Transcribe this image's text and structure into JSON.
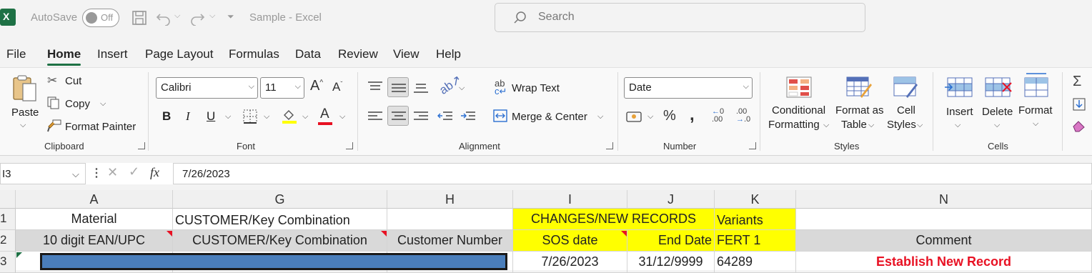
{
  "titlebar": {
    "app_icon": "excel-logo-icon",
    "autosave_label": "AutoSave",
    "autosave_state": "Off",
    "doc_title": "Sample  -  Excel",
    "search_placeholder": "Search"
  },
  "menu": {
    "tabs": [
      "File",
      "Home",
      "Insert",
      "Page Layout",
      "Formulas",
      "Data",
      "Review",
      "View",
      "Help"
    ],
    "active": "Home"
  },
  "ribbon": {
    "clipboard": {
      "paste": "Paste",
      "cut": "Cut",
      "copy": "Copy",
      "format_painter": "Format Painter",
      "label": "Clipboard"
    },
    "font": {
      "name": "Calibri",
      "size": "11",
      "label": "Font",
      "bold": "B",
      "italic": "I",
      "underline": "U"
    },
    "alignment": {
      "wrap": "Wrap Text",
      "merge": "Merge & Center",
      "label": "Alignment"
    },
    "number": {
      "format": "Date",
      "label": "Number"
    },
    "styles": {
      "conditional_1": "Conditional",
      "conditional_2": "Formatting",
      "table_1": "Format as",
      "table_2": "Table",
      "cell_1": "Cell",
      "cell_2": "Styles",
      "label": "Styles"
    },
    "cells": {
      "insert": "Insert",
      "delete": "Delete",
      "format": "Format",
      "label": "Cells"
    }
  },
  "formula_bar": {
    "name_box": "I3",
    "fx": "fx",
    "content": "7/26/2023"
  },
  "sheet": {
    "columns": [
      "A",
      "G",
      "H",
      "I",
      "J",
      "K",
      "N"
    ],
    "rows": [
      "1",
      "2",
      "3"
    ],
    "row1": {
      "A": "Material",
      "G": "CUSTOMER/Key Combination",
      "IJ": "CHANGES/NEW RECORDS",
      "K": "Variants"
    },
    "row2": {
      "A": "10 digit EAN/UPC",
      "G": "CUSTOMER/Key Combination",
      "H": "Customer Number",
      "I": "SOS date",
      "J": "End Date",
      "K": "FERT 1",
      "N": "Comment"
    },
    "row3": {
      "I": "7/26/2023",
      "J": "31/12/9999",
      "K": "64289",
      "N": "Establish New Record"
    },
    "colors": {
      "highlight_yellow": "#ffff00",
      "header_grey": "#d9d9d9",
      "redacted_bar": "#4a7ebb",
      "comment_red": "#e81123"
    }
  }
}
